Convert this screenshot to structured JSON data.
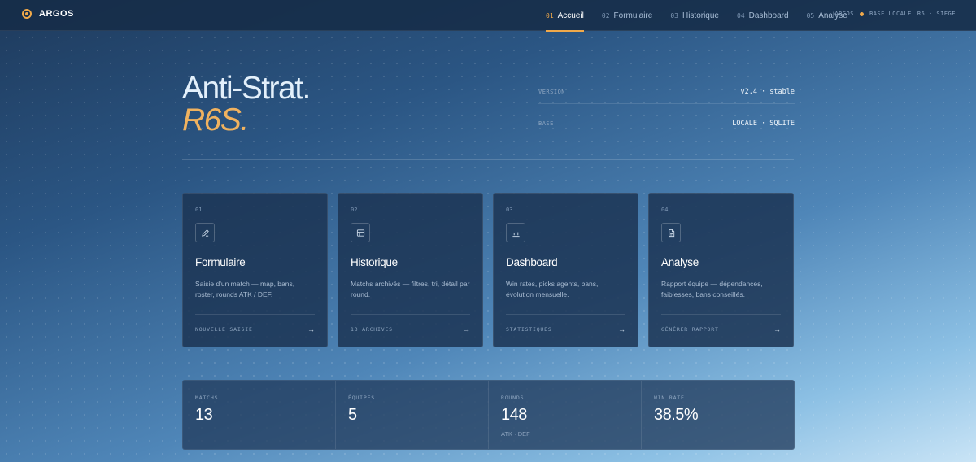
{
  "nav": {
    "brand": "ARGOS",
    "tabs": [
      {
        "num": "01",
        "label": "Accueil",
        "active": true
      },
      {
        "num": "02",
        "label": "Formulaire",
        "active": false
      },
      {
        "num": "03",
        "label": "Historique",
        "active": false
      },
      {
        "num": "04",
        "label": "Dashboard",
        "active": false
      },
      {
        "num": "05",
        "label": "Analyse",
        "active": false
      }
    ],
    "status_app": "ARGOS",
    "status_db": "BASE LOCALE",
    "status_game": "R6 · SIEGE"
  },
  "hero": {
    "title": "Anti-Strat.",
    "subtitle": "R6S."
  },
  "meta": [
    {
      "key": "VERSION",
      "value": "v2.4 · stable"
    },
    {
      "key": "BASE",
      "value": "LOCALE · SQLITE"
    }
  ],
  "cards": [
    {
      "num": "01",
      "icon": "pencil-icon",
      "title": "Formulaire",
      "desc": "Saisie d'un match — map, bans, roster, rounds ATK / DEF.",
      "action": "NOUVELLE SAISIE",
      "arrow": "→"
    },
    {
      "num": "02",
      "icon": "table-icon",
      "title": "Historique",
      "desc": "Matchs archivés — filtres, tri, détail par round.",
      "action": "13 ARCHIVES",
      "arrow": "→"
    },
    {
      "num": "03",
      "icon": "bar-chart-icon",
      "title": "Dashboard",
      "desc": "Win rates, picks agents, bans, évolution mensuelle.",
      "action": "STATISTIQUES",
      "arrow": "→"
    },
    {
      "num": "04",
      "icon": "document-icon",
      "title": "Analyse",
      "desc": "Rapport équipe — dépendances, faiblesses, bans conseillés.",
      "action": "GÉNÉRER RAPPORT",
      "arrow": "→"
    }
  ],
  "stats": [
    {
      "label": "MATCHS",
      "value": "13",
      "note": ""
    },
    {
      "label": "ÉQUIPES",
      "value": "5",
      "note": ""
    },
    {
      "label": "ROUNDS",
      "value": "148",
      "note": "ATK · DEF"
    },
    {
      "label": "WIN RATE",
      "value": "38.5%",
      "note": ""
    }
  ],
  "colors": {
    "accent": "#f0a94a",
    "card_bg": "#1c3454"
  }
}
